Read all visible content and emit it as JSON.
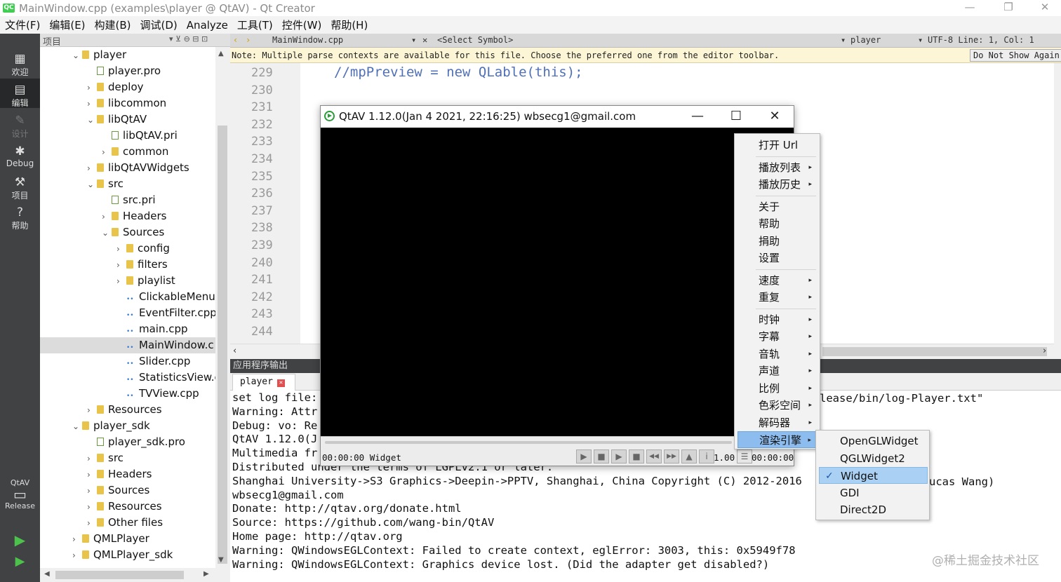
{
  "window": {
    "logo": "QC",
    "title": "MainWindow.cpp (examples\\player @ QtAV) - Qt Creator",
    "minimize": "—",
    "restore": "❐",
    "close": "✕"
  },
  "menu": [
    "文件(F)",
    "编辑(E)",
    "构建(B)",
    "调试(D)",
    "Analyze",
    "工具(T)",
    "控件(W)",
    "帮助(H)"
  ],
  "modes": {
    "welcome": "欢迎",
    "edit": "编辑",
    "design": "设计",
    "debug": "Debug",
    "project": "项目",
    "help": "帮助",
    "kit": "QtAV",
    "build_config": "Release"
  },
  "project_panel": {
    "title": "项目",
    "tree": [
      {
        "label": "player",
        "arrow": "⌄",
        "icon": "folder"
      },
      {
        "label": "player.pro",
        "arrow": "",
        "icon": "pro"
      },
      {
        "label": "deploy",
        "arrow": "›",
        "icon": "folder"
      },
      {
        "label": "libcommon",
        "arrow": "›",
        "icon": "folder"
      },
      {
        "label": "libQtAV",
        "arrow": "⌄",
        "icon": "folder"
      },
      {
        "label": "libQtAV.pri",
        "arrow": "",
        "icon": "pro"
      },
      {
        "label": "common",
        "arrow": "›",
        "icon": "folder"
      },
      {
        "label": "libQtAVWidgets",
        "arrow": "›",
        "icon": "folder"
      },
      {
        "label": "src",
        "arrow": "⌄",
        "icon": "folder"
      },
      {
        "label": "src.pri",
        "arrow": "",
        "icon": "pro"
      },
      {
        "label": "Headers",
        "arrow": "›",
        "icon": "folder"
      },
      {
        "label": "Sources",
        "arrow": "⌄",
        "icon": "folder"
      },
      {
        "label": "config",
        "arrow": "›",
        "icon": "folder"
      },
      {
        "label": "filters",
        "arrow": "›",
        "icon": "folder"
      },
      {
        "label": "playlist",
        "arrow": "›",
        "icon": "folder"
      },
      {
        "label": "ClickableMenu",
        "arrow": "",
        "icon": "cpp"
      },
      {
        "label": "EventFilter.cpp",
        "arrow": "",
        "icon": "cpp"
      },
      {
        "label": "main.cpp",
        "arrow": "",
        "icon": "cpp"
      },
      {
        "label": "MainWindow.c",
        "arrow": "",
        "icon": "cpp"
      },
      {
        "label": "Slider.cpp",
        "arrow": "",
        "icon": "cpp"
      },
      {
        "label": "StatisticsView.c",
        "arrow": "",
        "icon": "cpp"
      },
      {
        "label": "TVView.cpp",
        "arrow": "",
        "icon": "cpp"
      },
      {
        "label": "Resources",
        "arrow": "›",
        "icon": "folder"
      },
      {
        "label": "player_sdk",
        "arrow": "⌄",
        "icon": "folder"
      },
      {
        "label": "player_sdk.pro",
        "arrow": "",
        "icon": "pro"
      },
      {
        "label": "src",
        "arrow": "›",
        "icon": "folder"
      },
      {
        "label": "Headers",
        "arrow": "›",
        "icon": "folder"
      },
      {
        "label": "Sources",
        "arrow": "›",
        "icon": "folder"
      },
      {
        "label": "Resources",
        "arrow": "›",
        "icon": "folder"
      },
      {
        "label": "Other files",
        "arrow": "›",
        "icon": "folder"
      },
      {
        "label": "QMLPlayer",
        "arrow": "›",
        "icon": "folder"
      },
      {
        "label": "QMLPlayer_sdk",
        "arrow": "›",
        "icon": "folder"
      }
    ]
  },
  "editor_toolbar": {
    "file": "MainWindow.cpp",
    "symbol": "<Select Symbol>",
    "project": "player",
    "status": "UTF-8 Line: 1, Col: 1"
  },
  "note": {
    "text": "Note: Multiple parse contexts are available for this file. Choose the preferred one from the editor toolbar.",
    "button": "Do Not Show Again"
  },
  "editor": {
    "line_numbers": [
      "229",
      "230",
      "231",
      "232",
      "233",
      "234",
      "235",
      "236",
      "237",
      "238",
      "239",
      "240",
      "241",
      "242",
      "243",
      "244"
    ],
    "code_line": "//mpPreview = new QLable(this);"
  },
  "output": {
    "header": "应用程序输出",
    "tab": "player",
    "lines": [
      "set log file:",
      "Warning: Attr",
      "Debug: vo: Re",
      "QtAV 1.12.0(J",
      "Multimedia fr",
      "Distributed under the terms of LGPLv2.1 or later.",
      "Shanghai University->S3 Graphics->Deepin->PPTV, Shanghai, China Copyright (C) 2012-2016",
      "wbsecg1@gmail.com",
      "Donate: http://qtav.org/donate.html",
      "Source: https://github.com/wang-bin/QtAV",
      "Home page: http://qtav.org",
      "Warning: QWindowsEGLContext: Failed to create context, eglError: 3003, this: 0x5949f78",
      "Warning: QWindowsEGLContext: Graphics device lost. (Did the adapter get disabled?)"
    ],
    "right_fragment_1": "lease/bin/log-Player.txt\"",
    "right_fragment_2": "ucas Wang)"
  },
  "player_window": {
    "title": "QtAV 1.12.0(Jan  4 2021, 22:16:25) wbsecg1@gmail.com",
    "time_left": "00:00:00 Widget",
    "speed": "1.00",
    "time_right": "00:00:00",
    "minimize": "—",
    "maximize": "☐",
    "close": "✕",
    "controls": {
      "capture": "▶",
      "stop_record": "■",
      "play": "▶",
      "stop": "■",
      "back": "◀◀",
      "forward": "▶▶",
      "open": "▲",
      "info": "i",
      "menu": "☰"
    }
  },
  "context_menu": {
    "items": [
      {
        "label": "打开 Url",
        "sub": ""
      },
      {
        "label": "播放列表",
        "sub": "▸"
      },
      {
        "label": "播放历史",
        "sub": "▸"
      },
      {
        "label": "关于",
        "sub": ""
      },
      {
        "label": "帮助",
        "sub": ""
      },
      {
        "label": "捐助",
        "sub": ""
      },
      {
        "label": "设置",
        "sub": ""
      },
      {
        "label": "速度",
        "sub": "▸"
      },
      {
        "label": "重复",
        "sub": "▸"
      },
      {
        "label": "时钟",
        "sub": "▸"
      },
      {
        "label": "字幕",
        "sub": "▸"
      },
      {
        "label": "音轨",
        "sub": "▸"
      },
      {
        "label": "声道",
        "sub": "▸"
      },
      {
        "label": "比例",
        "sub": "▸"
      },
      {
        "label": "色彩空间",
        "sub": "▸"
      },
      {
        "label": "解码器",
        "sub": "▸"
      },
      {
        "label": "渲染引擎",
        "sub": "▸"
      }
    ],
    "highlighted": "渲染引擎"
  },
  "render_submenu": {
    "items": [
      "OpenGLWidget",
      "QGLWidget2",
      "Widget",
      "GDI",
      "Direct2D"
    ],
    "checked": "Widget",
    "check": "✓"
  },
  "watermark": "@稀土掘金技术社区",
  "colors": {
    "modebar": "#404244",
    "menu_highlight": "#8dbdee",
    "code": "#4f70b7",
    "note_bg": "#fcf6d6"
  }
}
